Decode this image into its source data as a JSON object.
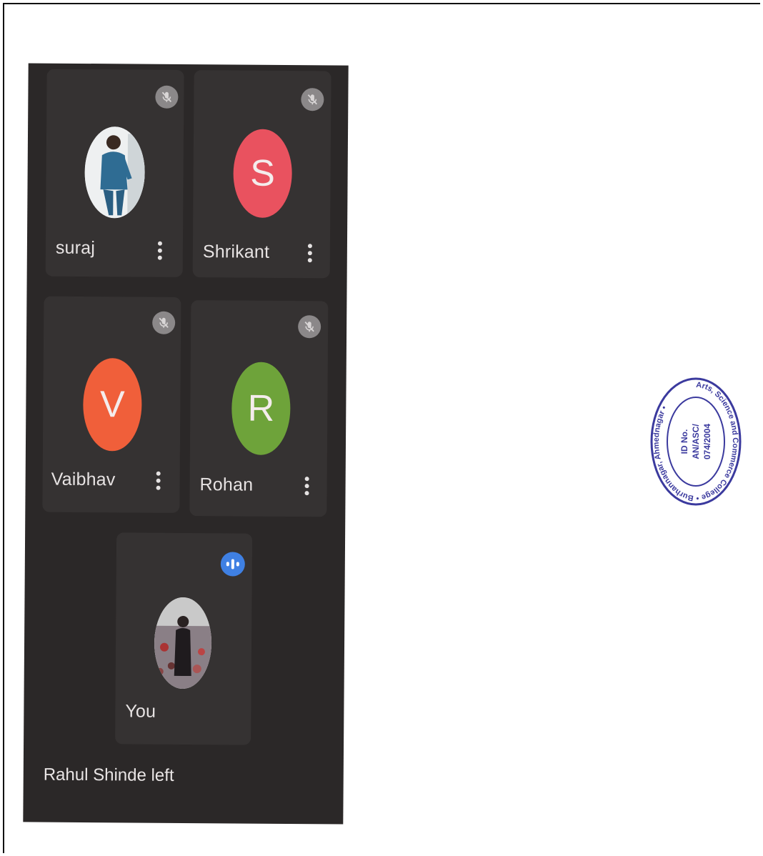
{
  "participants": [
    {
      "name": "suraj",
      "avatar_type": "photo",
      "muted": true
    },
    {
      "name": "Shrikant",
      "avatar_type": "letter",
      "letter": "S",
      "color": "#e9525f",
      "muted": true
    },
    {
      "name": "Vaibhav",
      "avatar_type": "letter",
      "letter": "V",
      "color": "#f05f3a",
      "muted": true
    },
    {
      "name": "Rohan",
      "avatar_type": "letter",
      "letter": "R",
      "color": "#6ea33a",
      "muted": true
    }
  ],
  "self_tile": {
    "name": "You",
    "avatar_type": "photo",
    "speaking": true,
    "indicator_color": "#3f80e3"
  },
  "notification": "Rahul Shinde left",
  "stamp": {
    "ring_text": "Arts, Science and Commerce College • Burhannagar, Ahmednagar •",
    "center_lines": [
      "ID No.",
      "AN/ASC/",
      "074/2004"
    ],
    "color": "#3b3a9e"
  },
  "icons": {
    "mic_off": "mic-off-icon",
    "more": "more-vertical-icon",
    "speaking": "audio-level-icon"
  }
}
